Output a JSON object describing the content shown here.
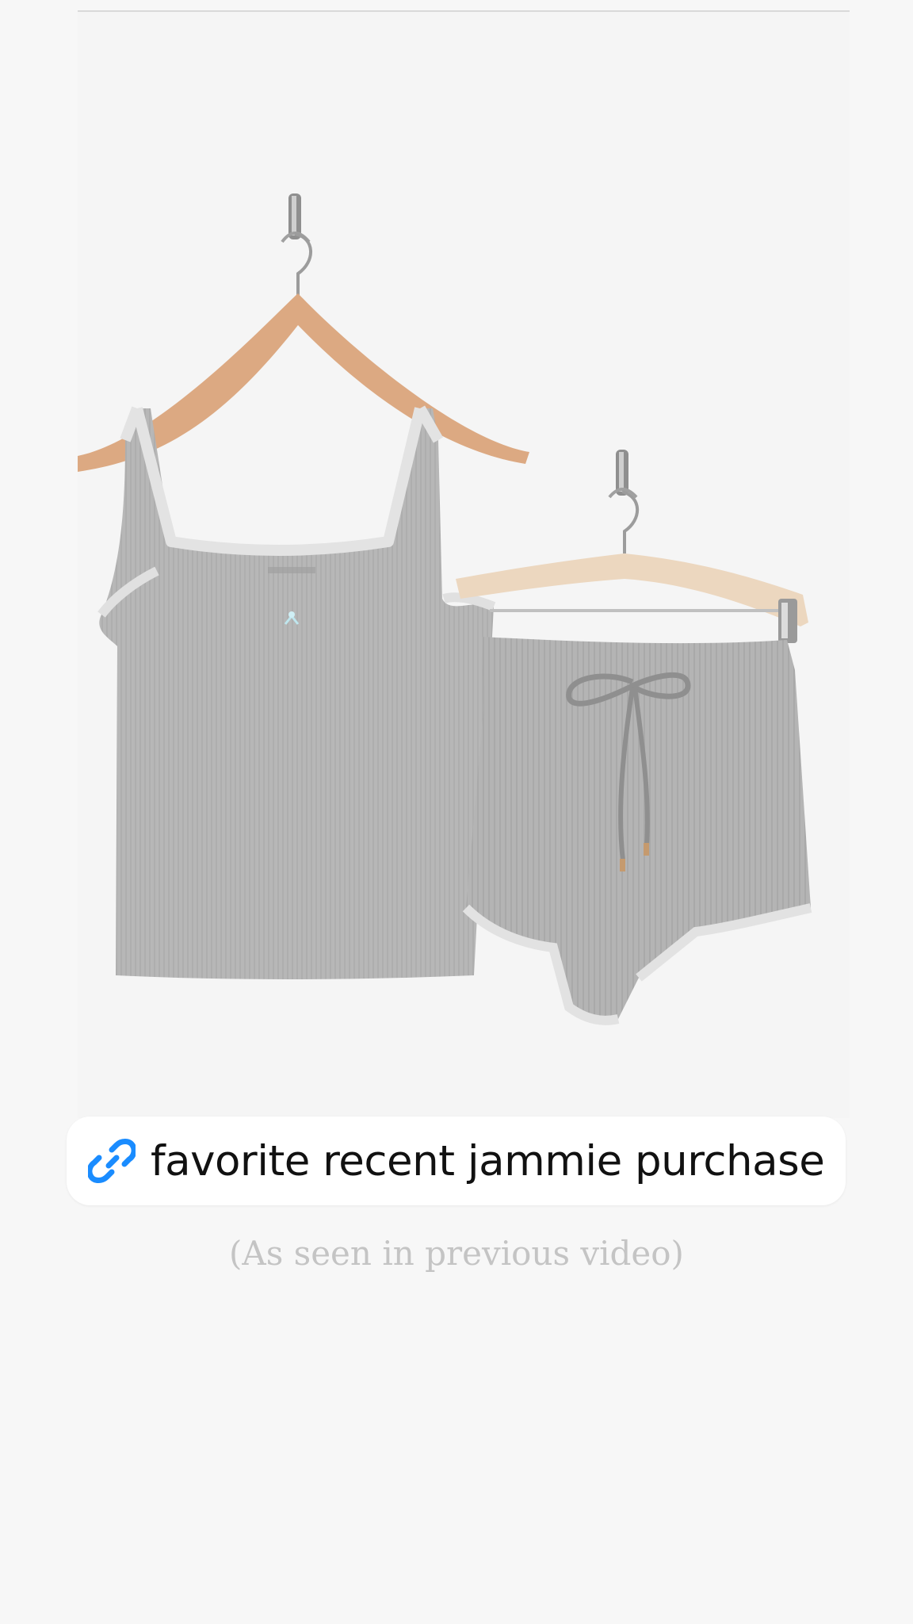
{
  "product_image": {
    "alt": "grey ribbed lace-trim tank and shorts pajama set on hangers"
  },
  "link_sticker": {
    "icon": "link-icon",
    "label": "favorite recent jammie purchase",
    "icon_color": "#1a8cff"
  },
  "caption": {
    "text": "(As seen in previous video)"
  },
  "colors": {
    "background": "#f7f7f7",
    "sticker_background": "#ffffff",
    "garment_grey": "#b3b3b3",
    "caption_grey": "#c4c4c4"
  }
}
